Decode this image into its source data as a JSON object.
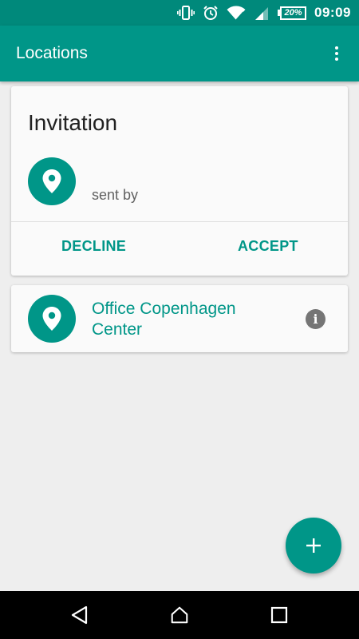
{
  "status_bar": {
    "battery_percent": "20%",
    "time": "09:09",
    "icons": [
      "vibrate-icon",
      "alarm-icon",
      "wifi-icon",
      "signal-icon",
      "battery-icon"
    ]
  },
  "app_bar": {
    "title": "Locations",
    "menu_icon": "overflow-menu-icon"
  },
  "invitation_card": {
    "title": "Invitation",
    "sent_by_label": "sent by",
    "icon": "location-pin-icon",
    "decline_label": "DECLINE",
    "accept_label": "ACCEPT"
  },
  "locations": [
    {
      "name": "Office Copenhagen Center",
      "icon": "location-pin-icon",
      "info_icon": "info-icon"
    }
  ],
  "fab": {
    "icon": "add-icon"
  },
  "navigation": {
    "back_icon": "back-icon",
    "home_icon": "home-icon",
    "recent_icon": "recent-apps-icon"
  },
  "colors": {
    "primary": "#009688",
    "primary_dark": "#00897b",
    "background": "#eeeeee",
    "card": "#fafafa"
  }
}
